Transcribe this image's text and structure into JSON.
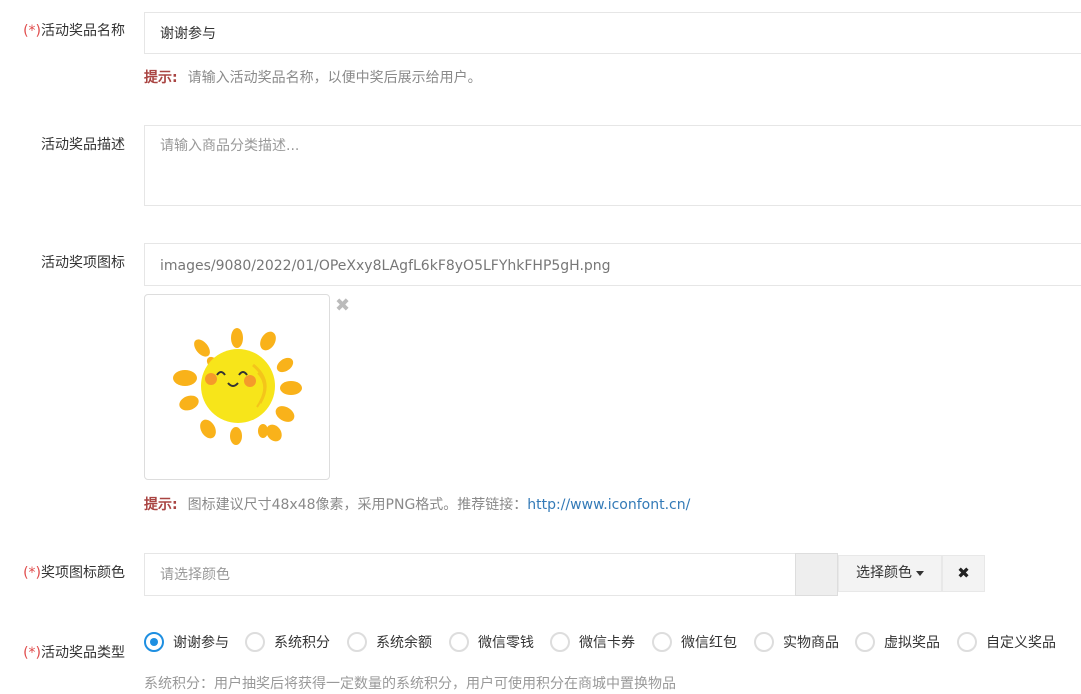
{
  "form": {
    "name": {
      "required_mark": "(*)",
      "label": "活动奖品名称",
      "value": "谢谢参与",
      "hint_title": "提示:",
      "hint_text": "请输入活动奖品名称，以便中奖后展示给用户。"
    },
    "description": {
      "label": "活动奖品描述",
      "placeholder": "请输入商品分类描述..."
    },
    "icon": {
      "label": "活动奖项图标",
      "value": "images/9080/2022/01/OPeXxy8LAgfL6kF8yO5LFYhkFHP5gH.png",
      "remove_glyph": "✖",
      "hint_title": "提示:",
      "hint_text": "图标建议尺寸48x48像素，采用PNG格式。推荐链接：",
      "hint_link": "http://www.iconfont.cn/"
    },
    "icon_color": {
      "required_mark": "(*)",
      "label": "奖项图标颜色",
      "placeholder": "请选择颜色",
      "choose_label": "选择颜色",
      "clear_glyph": "✖"
    },
    "prize_type": {
      "required_mark": "(*)",
      "label": "活动奖品类型",
      "selected": "谢谢参与",
      "options": [
        "谢谢参与",
        "系统积分",
        "系统余额",
        "微信零钱",
        "微信卡券",
        "微信红包",
        "实物商品",
        "虚拟奖品",
        "自定义奖品"
      ],
      "note_partial": "系统积分：用户抽奖后将获得一定数量的系统积分，用户可使用积分在商城中置换物品"
    }
  },
  "colors": {
    "accent": "#1e8fe1",
    "required": "#e04b4b",
    "hint_title": "#a94442",
    "link": "#337ab7"
  }
}
